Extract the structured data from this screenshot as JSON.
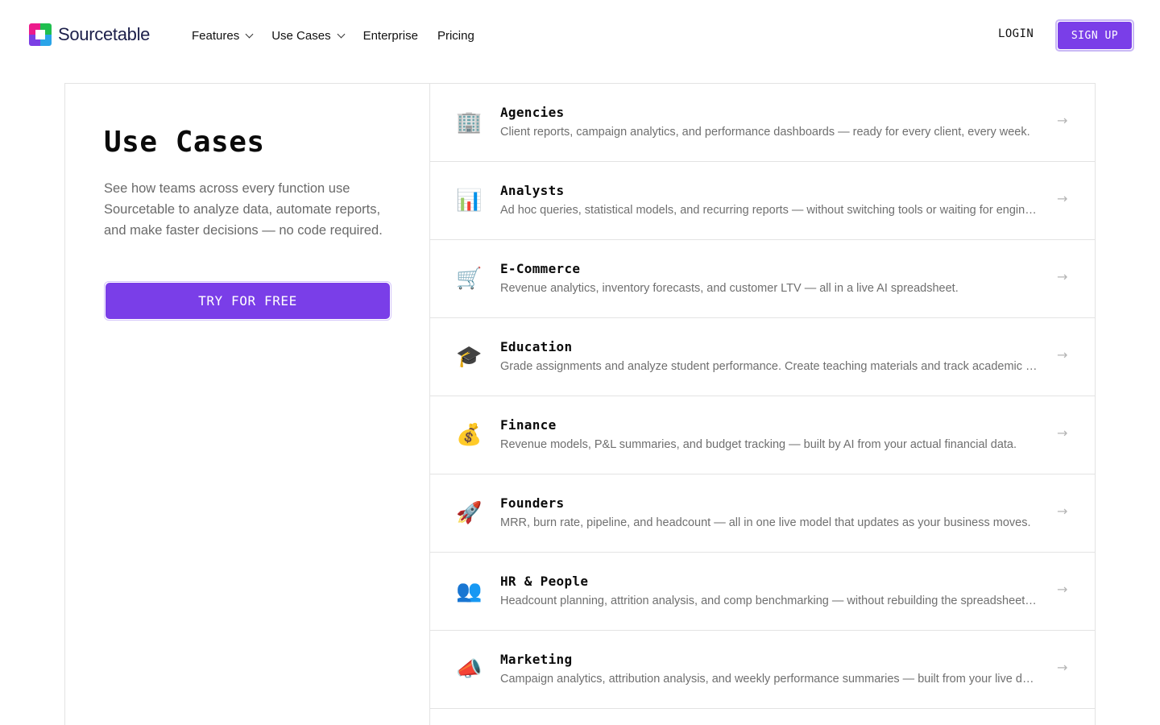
{
  "header": {
    "logo_text": "Sourcetable",
    "nav": [
      {
        "label": "Features",
        "has_dropdown": true
      },
      {
        "label": "Use Cases",
        "has_dropdown": true
      },
      {
        "label": "Enterprise",
        "has_dropdown": false
      },
      {
        "label": "Pricing",
        "has_dropdown": false
      }
    ],
    "login_label": "LOGIN",
    "signup_label": "SIGN UP"
  },
  "colors": {
    "accent": "#7a3ee8",
    "muted_text": "#6f6f6f",
    "border": "#e3e3e3"
  },
  "intro": {
    "title": "Use Cases",
    "description": "See how teams across every function use Sourcetable to analyze data, automate reports, and make faster decisions — no code required.",
    "cta_label": "TRY FOR FREE"
  },
  "use_cases": [
    {
      "icon": "office-building-icon",
      "glyph": "🏢",
      "title": "Agencies",
      "description": "Client reports, campaign analytics, and performance dashboards — ready for every client, every week.",
      "arrow": "→"
    },
    {
      "icon": "bar-chart-icon",
      "glyph": "📊",
      "title": "Analysts",
      "description": "Ad hoc queries, statistical models, and recurring reports — without switching tools or waiting for engineering.",
      "arrow": "→"
    },
    {
      "icon": "shopping-cart-icon",
      "glyph": "🛒",
      "title": "E-Commerce",
      "description": "Revenue analytics, inventory forecasts, and customer LTV — all in a live AI spreadsheet.",
      "arrow": "→"
    },
    {
      "icon": "graduation-cap-icon",
      "glyph": "🎓",
      "title": "Education",
      "description": "Grade assignments and analyze student performance. Create teaching materials and track academic progress.",
      "arrow": "→"
    },
    {
      "icon": "money-bag-icon",
      "glyph": "💰",
      "title": "Finance",
      "description": "Revenue models, P&L summaries, and budget tracking — built by AI from your actual financial data.",
      "arrow": "→"
    },
    {
      "icon": "rocket-icon",
      "glyph": "🚀",
      "title": "Founders",
      "description": "MRR, burn rate, pipeline, and headcount — all in one live model that updates as your business moves.",
      "arrow": "→"
    },
    {
      "icon": "people-icon",
      "glyph": "👥",
      "title": "HR & People",
      "description": "Headcount planning, attrition analysis, and comp benchmarking — without rebuilding the spreadsheet every quarter.",
      "arrow": "→"
    },
    {
      "icon": "megaphone-icon",
      "glyph": "📣",
      "title": "Marketing",
      "description": "Campaign analytics, attribution analysis, and weekly performance summaries — built from your live data.",
      "arrow": "→"
    }
  ]
}
